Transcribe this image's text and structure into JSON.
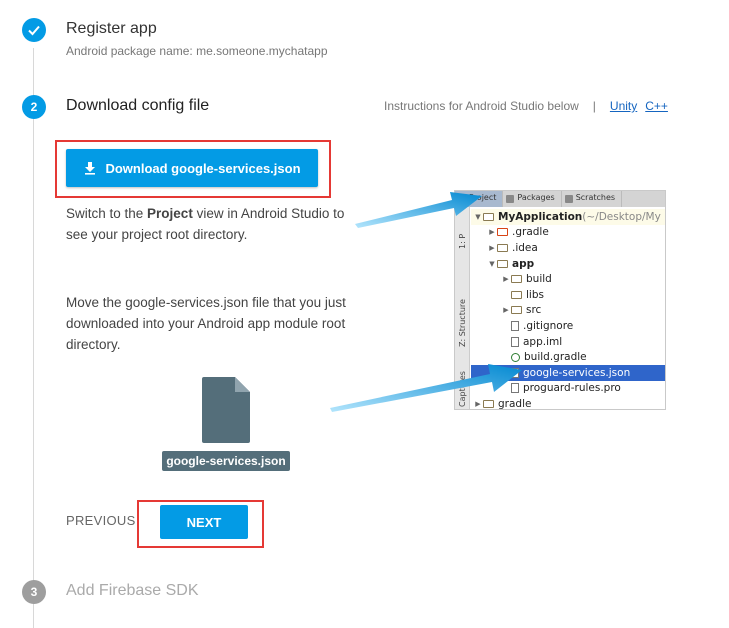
{
  "steps": [
    {
      "number": "✓",
      "title": "Register app",
      "subtitle": "Android package name: me.someone.mychatapp"
    },
    {
      "number": "2",
      "title": "Download config file"
    },
    {
      "number": "3",
      "title": "Add Firebase SDK"
    }
  ],
  "instructions": {
    "text": "Instructions for Android Studio below",
    "separator": "|",
    "links": [
      "Unity",
      "C++"
    ]
  },
  "download_button": "Download google-services.json",
  "paragraph1": {
    "before": "Switch to the ",
    "bold": "Project",
    "after": " view in Android Studio to see your project root directory."
  },
  "paragraph2": "Move the google-services.json file that you just downloaded into your Android app module root directory.",
  "file_label": "google-services.json",
  "nav": {
    "previous": "PREVIOUS",
    "next": "NEXT"
  },
  "ide": {
    "tabs": [
      "Project",
      "Packages",
      "Scratches"
    ],
    "side_labels": [
      "1: P",
      "Z: Structure",
      "Captures"
    ],
    "tree": [
      {
        "indent": 0,
        "toggle": "▼",
        "icon": "folder",
        "label": "MyApplication",
        "suffix": " (~/Desktop/My",
        "bold": true,
        "root": true
      },
      {
        "indent": 1,
        "toggle": "▶",
        "icon": "folder-red",
        "label": ".gradle"
      },
      {
        "indent": 1,
        "toggle": "▶",
        "icon": "folder",
        "label": ".idea"
      },
      {
        "indent": 1,
        "toggle": "▼",
        "icon": "folder",
        "label": "app",
        "bold": true
      },
      {
        "indent": 2,
        "toggle": "▶",
        "icon": "folder",
        "label": "build"
      },
      {
        "indent": 2,
        "toggle": "",
        "icon": "folder",
        "label": "libs"
      },
      {
        "indent": 2,
        "toggle": "▶",
        "icon": "folder",
        "label": "src"
      },
      {
        "indent": 2,
        "toggle": "",
        "icon": "file",
        "label": ".gitignore"
      },
      {
        "indent": 2,
        "toggle": "",
        "icon": "file",
        "label": "app.iml"
      },
      {
        "indent": 2,
        "toggle": "",
        "icon": "gradle",
        "label": "build.gradle"
      },
      {
        "indent": 2,
        "toggle": "",
        "icon": "file",
        "label": "google-services.json",
        "selected": true
      },
      {
        "indent": 2,
        "toggle": "",
        "icon": "file",
        "label": "proguard-rules.pro"
      },
      {
        "indent": 0,
        "toggle": "▶",
        "icon": "folder",
        "label": "gradle"
      }
    ]
  },
  "colors": {
    "accent": "#039be5",
    "highlight": "#e53935",
    "file_gray": "#546e7a",
    "selection": "#2f65ca"
  }
}
